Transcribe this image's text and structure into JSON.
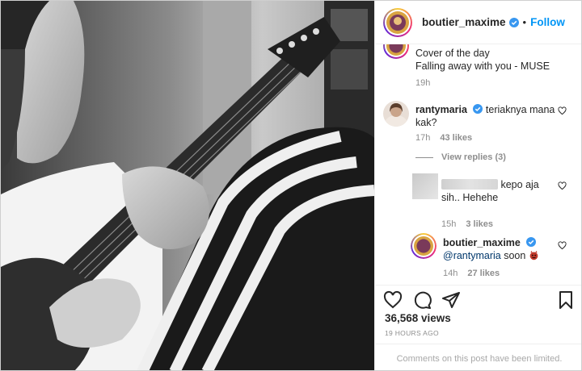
{
  "header": {
    "username": "boutier_maxime",
    "dot": "•",
    "follow_label": "Follow"
  },
  "caption": {
    "line1": "Cover of the day",
    "line2": "Falling away with you - MUSE",
    "time": "19h"
  },
  "comments": [
    {
      "username": "rantymaria",
      "text": "teriaknya mana kak?",
      "time": "17h",
      "likes": "43 likes"
    }
  ],
  "view_replies": "View replies (3)",
  "replies": [
    {
      "username_hidden": true,
      "text_before": "",
      "text": "kepo aja sih.. Hehehe",
      "time": "15h",
      "likes": "3 likes"
    },
    {
      "username": "boutier_maxime",
      "mention": "@rantymaria",
      "text": "soon",
      "emoji": "devil-emoji",
      "time": "14h",
      "likes": "27 likes"
    }
  ],
  "actions": {
    "views": "36,568 views",
    "posted": "19 HOURS AGO",
    "comments_limited": "Comments on this post have been limited.",
    "icons": [
      "heart-icon",
      "comment-icon",
      "share-icon",
      "bookmark-icon"
    ]
  },
  "colors": {
    "link": "#0095f6",
    "muted": "#8e8e8e",
    "text": "#262626",
    "mention": "#00376b"
  }
}
